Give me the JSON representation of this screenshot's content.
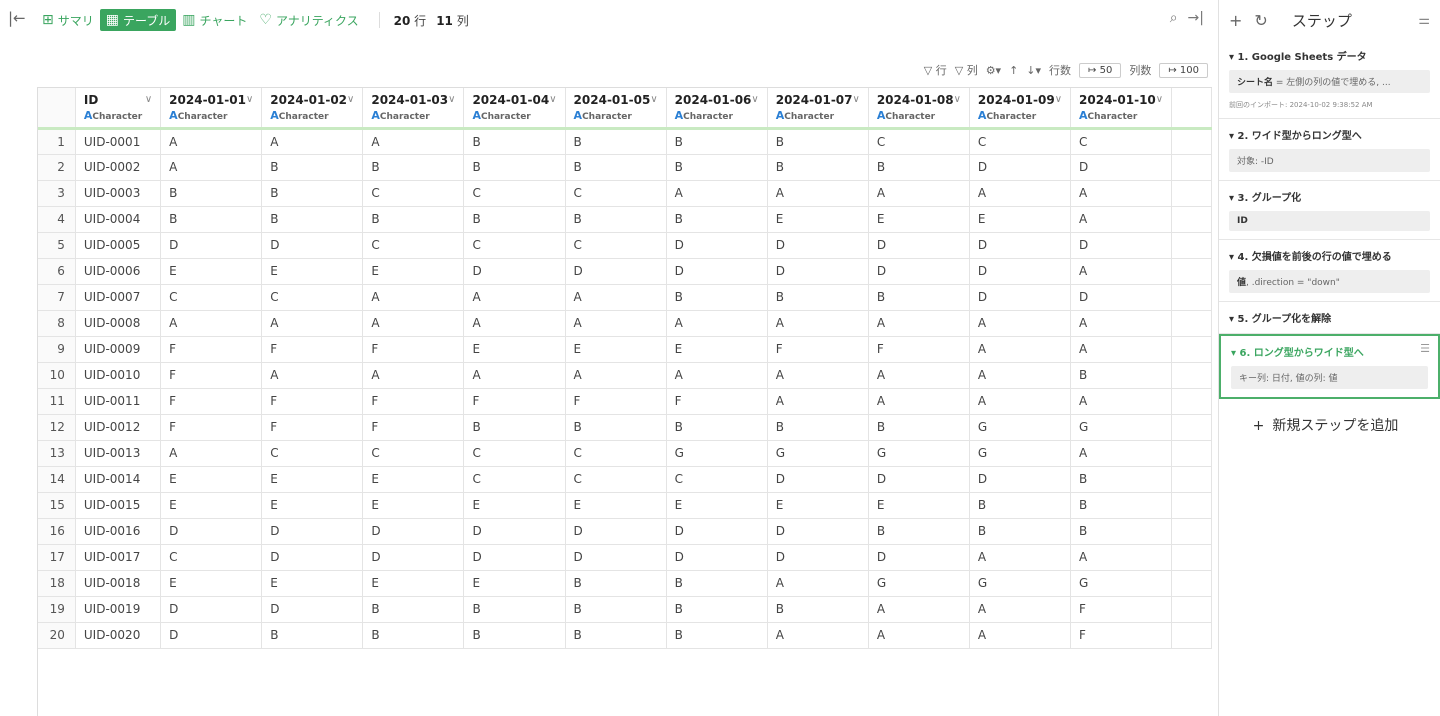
{
  "toolbar": {
    "tabs": [
      {
        "label": "サマリ",
        "icon": "grid-icon"
      },
      {
        "label": "テーブル",
        "icon": "table-icon"
      },
      {
        "label": "チャート",
        "icon": "chart-icon"
      },
      {
        "label": "アナリティクス",
        "icon": "bulb-icon"
      }
    ],
    "rows_num": "20",
    "rows_label": "行",
    "cols_num": "11",
    "cols_label": "列"
  },
  "subbar": {
    "row_filter": "行",
    "col_filter": "列",
    "rows_label": "行数",
    "rows_limit": "↦ 50",
    "cols_label": "列数",
    "cols_limit": "↦ 100"
  },
  "columns": [
    {
      "name": "ID",
      "type": "Character"
    },
    {
      "name": "2024-01-01",
      "type": "Character"
    },
    {
      "name": "2024-01-02",
      "type": "Character"
    },
    {
      "name": "2024-01-03",
      "type": "Character"
    },
    {
      "name": "2024-01-04",
      "type": "Character"
    },
    {
      "name": "2024-01-05",
      "type": "Character"
    },
    {
      "name": "2024-01-06",
      "type": "Character"
    },
    {
      "name": "2024-01-07",
      "type": "Character"
    },
    {
      "name": "2024-01-08",
      "type": "Character"
    },
    {
      "name": "2024-01-09",
      "type": "Character"
    },
    {
      "name": "2024-01-10",
      "type": "Character"
    }
  ],
  "rows": [
    [
      "1",
      "UID-0001",
      "A",
      "A",
      "A",
      "B",
      "B",
      "B",
      "B",
      "C",
      "C",
      "C"
    ],
    [
      "2",
      "UID-0002",
      "A",
      "B",
      "B",
      "B",
      "B",
      "B",
      "B",
      "B",
      "D",
      "D"
    ],
    [
      "3",
      "UID-0003",
      "B",
      "B",
      "C",
      "C",
      "C",
      "A",
      "A",
      "A",
      "A",
      "A"
    ],
    [
      "4",
      "UID-0004",
      "B",
      "B",
      "B",
      "B",
      "B",
      "B",
      "E",
      "E",
      "E",
      "A"
    ],
    [
      "5",
      "UID-0005",
      "D",
      "D",
      "C",
      "C",
      "C",
      "D",
      "D",
      "D",
      "D",
      "D"
    ],
    [
      "6",
      "UID-0006",
      "E",
      "E",
      "E",
      "D",
      "D",
      "D",
      "D",
      "D",
      "D",
      "A"
    ],
    [
      "7",
      "UID-0007",
      "C",
      "C",
      "A",
      "A",
      "A",
      "B",
      "B",
      "B",
      "D",
      "D"
    ],
    [
      "8",
      "UID-0008",
      "A",
      "A",
      "A",
      "A",
      "A",
      "A",
      "A",
      "A",
      "A",
      "A"
    ],
    [
      "9",
      "UID-0009",
      "F",
      "F",
      "F",
      "E",
      "E",
      "E",
      "F",
      "F",
      "A",
      "A"
    ],
    [
      "10",
      "UID-0010",
      "F",
      "A",
      "A",
      "A",
      "A",
      "A",
      "A",
      "A",
      "A",
      "B"
    ],
    [
      "11",
      "UID-0011",
      "F",
      "F",
      "F",
      "F",
      "F",
      "F",
      "A",
      "A",
      "A",
      "A"
    ],
    [
      "12",
      "UID-0012",
      "F",
      "F",
      "F",
      "B",
      "B",
      "B",
      "B",
      "B",
      "G",
      "G"
    ],
    [
      "13",
      "UID-0013",
      "A",
      "C",
      "C",
      "C",
      "C",
      "G",
      "G",
      "G",
      "G",
      "A"
    ],
    [
      "14",
      "UID-0014",
      "E",
      "E",
      "E",
      "C",
      "C",
      "C",
      "D",
      "D",
      "D",
      "B"
    ],
    [
      "15",
      "UID-0015",
      "E",
      "E",
      "E",
      "E",
      "E",
      "E",
      "E",
      "E",
      "B",
      "B"
    ],
    [
      "16",
      "UID-0016",
      "D",
      "D",
      "D",
      "D",
      "D",
      "D",
      "D",
      "B",
      "B",
      "B"
    ],
    [
      "17",
      "UID-0017",
      "C",
      "D",
      "D",
      "D",
      "D",
      "D",
      "D",
      "D",
      "A",
      "A"
    ],
    [
      "18",
      "UID-0018",
      "E",
      "E",
      "E",
      "E",
      "B",
      "B",
      "A",
      "G",
      "G",
      "G"
    ],
    [
      "19",
      "UID-0019",
      "D",
      "D",
      "B",
      "B",
      "B",
      "B",
      "B",
      "A",
      "A",
      "F"
    ],
    [
      "20",
      "UID-0020",
      "D",
      "B",
      "B",
      "B",
      "B",
      "B",
      "A",
      "A",
      "A",
      "F"
    ]
  ],
  "panel": {
    "title": "ステップ",
    "steps": [
      {
        "title": "▾ 1. Google Sheets データ",
        "body_key": "シート名",
        "body_rest": " = 左側の列の値で埋める, ...",
        "note": "前回のインポート: 2024-10-02 9:38:52 AM"
      },
      {
        "title": "▾ 2. ワイド型からロング型へ",
        "body_key": "",
        "body_rest": "対象: -ID",
        "note": ""
      },
      {
        "title": "▾ 3. グループ化",
        "body_key": "ID",
        "body_rest": "",
        "note": ""
      },
      {
        "title": "▾ 4. 欠損値を前後の行の値で埋める",
        "body_key": "値",
        "body_rest": ", .direction = \"down\"",
        "note": ""
      },
      {
        "title": "▾ 5. グループ化を解除",
        "body_key": "",
        "body_rest": "",
        "note": ""
      },
      {
        "title": "▾ 6. ロング型からワイド型へ",
        "body_key": "",
        "body_rest": "キー列: 日付, 値の列: 値",
        "note": ""
      }
    ],
    "add_step": "新規ステップを追加"
  }
}
